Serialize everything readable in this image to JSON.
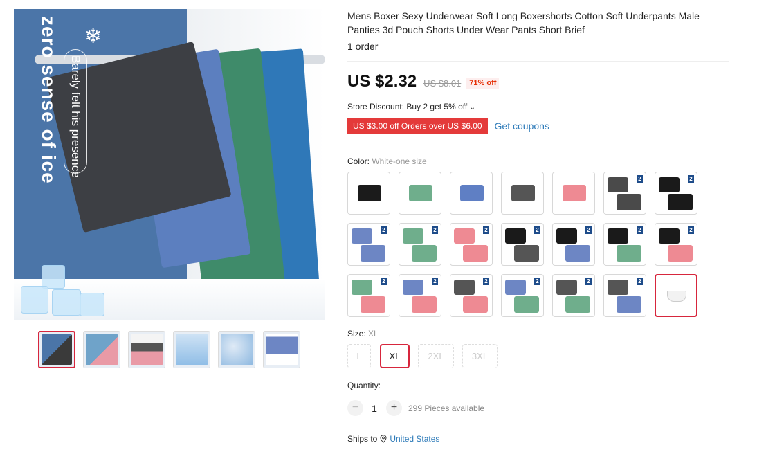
{
  "gallery": {
    "hero_text": "zero sense of ice",
    "hero_subtext": "Barely felt his presence",
    "thumbnails": [
      {
        "name": "thumb-1",
        "colors": [
          "#4b75a8",
          "#3a3a3a"
        ]
      },
      {
        "name": "thumb-2",
        "colors": [
          "#6fa3c9",
          "#e99aa6"
        ]
      },
      {
        "name": "thumb-3",
        "colors": [
          "#f4f4f4",
          "#555555"
        ]
      },
      {
        "name": "thumb-4",
        "colors": [
          "#cfe3f5",
          "#8fbde6"
        ]
      },
      {
        "name": "thumb-5",
        "colors": [
          "#8db8e0",
          "#dfeaf6"
        ]
      },
      {
        "name": "thumb-6",
        "colors": [
          "#6d86c4",
          "#ffffff"
        ]
      }
    ]
  },
  "product": {
    "title": "Mens Boxer Sexy Underwear Soft Long Boxershorts Cotton Soft Underpants Male Panties 3d Pouch Shorts Under Wear Pants Short Brief",
    "orders": "1 order",
    "price": "US $2.32",
    "old_price": "US $8.01",
    "discount": "71% off",
    "store_discount": "Store Discount: Buy 2 get 5% off",
    "coupon": "US $3.00 off Orders over US $6.00",
    "get_coupons": "Get coupons"
  },
  "color": {
    "label": "Color:",
    "selected": "White-one size",
    "options": [
      {
        "type": "single",
        "c1": "#1b1b1b"
      },
      {
        "type": "single",
        "c1": "#6fae8c"
      },
      {
        "type": "single",
        "c1": "#5f7fc4"
      },
      {
        "type": "single",
        "c1": "#555555"
      },
      {
        "type": "single",
        "c1": "#ee8a93"
      },
      {
        "type": "pair",
        "c1": "#4a4a4a",
        "c2": "#4a4a4a",
        "badge": "2"
      },
      {
        "type": "pair",
        "c1": "#1a1a1a",
        "c2": "#1a1a1a",
        "badge": "2"
      },
      {
        "type": "pair",
        "c1": "#6d86c4",
        "c2": "#6d86c4",
        "badge": "2"
      },
      {
        "type": "pair",
        "c1": "#6fae8c",
        "c2": "#6fae8c",
        "badge": "2"
      },
      {
        "type": "pair",
        "c1": "#ee8a93",
        "c2": "#ee8a93",
        "badge": "2"
      },
      {
        "type": "pair",
        "c1": "#1a1a1a",
        "c2": "#555555",
        "badge": "2"
      },
      {
        "type": "pair",
        "c1": "#1a1a1a",
        "c2": "#6d86c4",
        "badge": "2"
      },
      {
        "type": "pair",
        "c1": "#1a1a1a",
        "c2": "#6fae8c",
        "badge": "2"
      },
      {
        "type": "pair",
        "c1": "#1a1a1a",
        "c2": "#ee8a93",
        "badge": "2"
      },
      {
        "type": "pair",
        "c1": "#6fae8c",
        "c2": "#ee8a93",
        "badge": "2"
      },
      {
        "type": "pair",
        "c1": "#6d86c4",
        "c2": "#ee8a93",
        "badge": "2"
      },
      {
        "type": "pair",
        "c1": "#555555",
        "c2": "#ee8a93",
        "badge": "2"
      },
      {
        "type": "pair",
        "c1": "#6d86c4",
        "c2": "#6fae8c",
        "badge": "2"
      },
      {
        "type": "pair",
        "c1": "#555555",
        "c2": "#6fae8c",
        "badge": "2"
      },
      {
        "type": "pair",
        "c1": "#555555",
        "c2": "#6d86c4",
        "badge": "2"
      },
      {
        "type": "white",
        "c1": "#f2f2f2"
      }
    ]
  },
  "size": {
    "label": "Size:",
    "selected": "XL",
    "options": [
      "L",
      "XL",
      "2XL",
      "3XL"
    ]
  },
  "quantity": {
    "label": "Quantity:",
    "minus": "−",
    "value": "1",
    "plus": "+",
    "stock": "299 Pieces available"
  },
  "shipping": {
    "label": "Ships to",
    "country": "United States"
  },
  "colors": {
    "accent_red": "#d7263d",
    "link_blue": "#2e7bb9",
    "coupon_red": "#e43a3a"
  }
}
